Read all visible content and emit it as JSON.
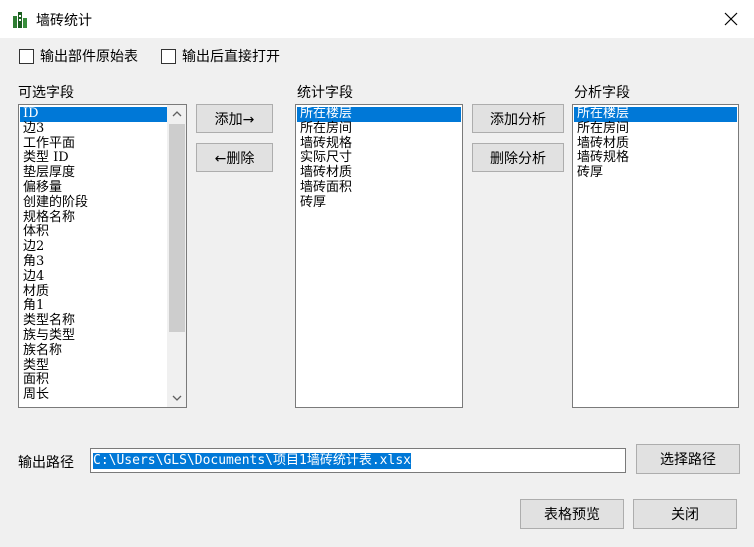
{
  "window": {
    "title": "墙砖统计",
    "close_icon": "close-icon"
  },
  "options": {
    "export_raw_label": "输出部件原始表",
    "export_raw_checked": false,
    "open_after_label": "输出后直接打开",
    "open_after_checked": false
  },
  "available": {
    "label": "可选字段",
    "items": [
      "ID",
      "边3",
      "工作平面",
      "类型 ID",
      "垫层厚度",
      "偏移量",
      "创建的阶段",
      "规格名称",
      "体积",
      "边2",
      "角3",
      "边4",
      "材质",
      "角1",
      "类型名称",
      "族与类型",
      "族名称",
      "类型",
      "面积",
      "周长"
    ],
    "selected_index": 0
  },
  "middle_buttons": {
    "add": "添加→",
    "remove": "←删除"
  },
  "stat": {
    "label": "统计字段",
    "items": [
      "所在楼层",
      "所在房间",
      "墙砖规格",
      "实际尺寸",
      "墙砖材质",
      "墙砖面积",
      "砖厚"
    ],
    "selected_index": 0
  },
  "analysis_buttons": {
    "add": "添加分析",
    "remove": "删除分析"
  },
  "analysis": {
    "label": "分析字段",
    "items": [
      "所在楼层",
      "所在房间",
      "墙砖材质",
      "墙砖规格",
      "砖厚"
    ],
    "selected_index": 0
  },
  "output": {
    "label": "输出路径",
    "path": "C:\\Users\\GLS\\Documents\\项目1墙砖统计表.xlsx",
    "browse": "选择路径"
  },
  "footer": {
    "preview": "表格预览",
    "close": "关闭"
  }
}
